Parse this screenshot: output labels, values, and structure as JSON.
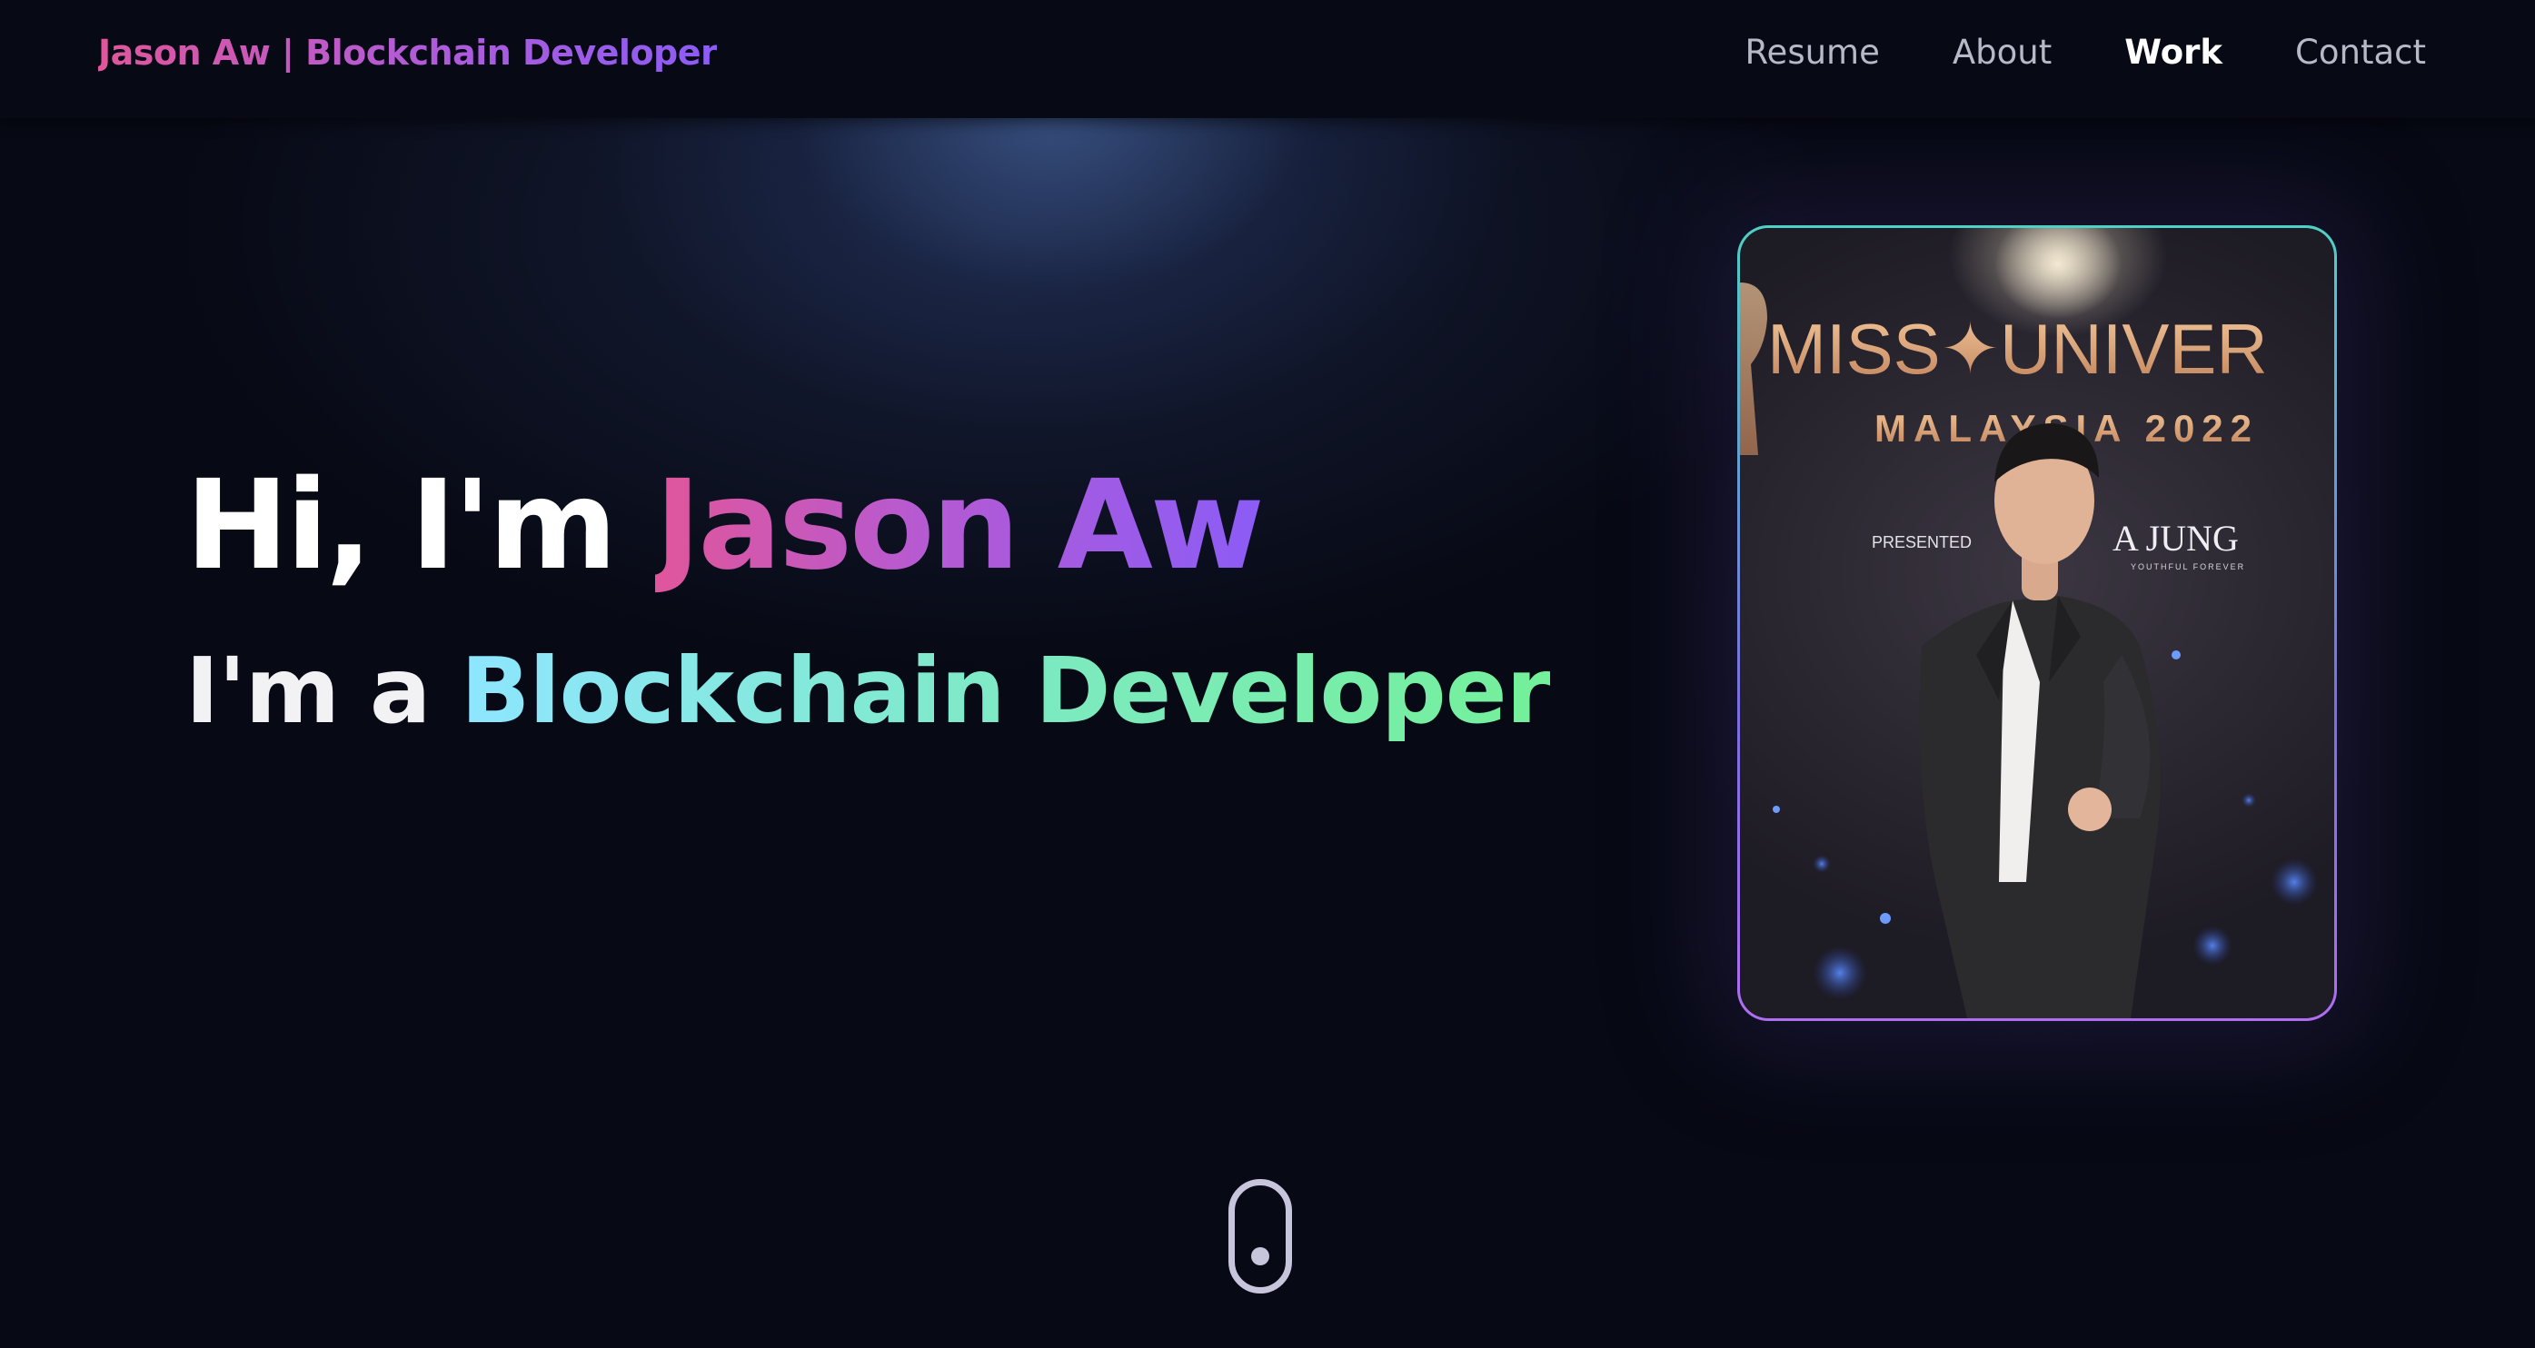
{
  "header": {
    "brand": "Jason Aw | Blockchain Developer",
    "nav": [
      {
        "label": "Resume",
        "active": false
      },
      {
        "label": "About",
        "active": false
      },
      {
        "label": "Work",
        "active": true
      },
      {
        "label": "Contact",
        "active": false
      }
    ]
  },
  "hero": {
    "greeting": "Hi, I'm",
    "name": "Jason Aw",
    "role_prefix": "I'm a",
    "role": "Blockchain Developer"
  },
  "photo": {
    "backdrop_line1": "MISS✦UNIVER",
    "backdrop_line2": "MALAYSIA 2022",
    "backdrop_presented": "PRESENTED",
    "backdrop_sponsor": "A JUNG",
    "backdrop_sponsor_tagline": "YOUTHFUL FOREVER"
  },
  "colors": {
    "background": "#070914",
    "name_gradient": [
      "#e0569b",
      "#8b5cf6"
    ],
    "role_gradient": [
      "#8ee6ff",
      "#74f09a"
    ]
  },
  "icons": {
    "scroll": "mouse-scroll-icon"
  }
}
